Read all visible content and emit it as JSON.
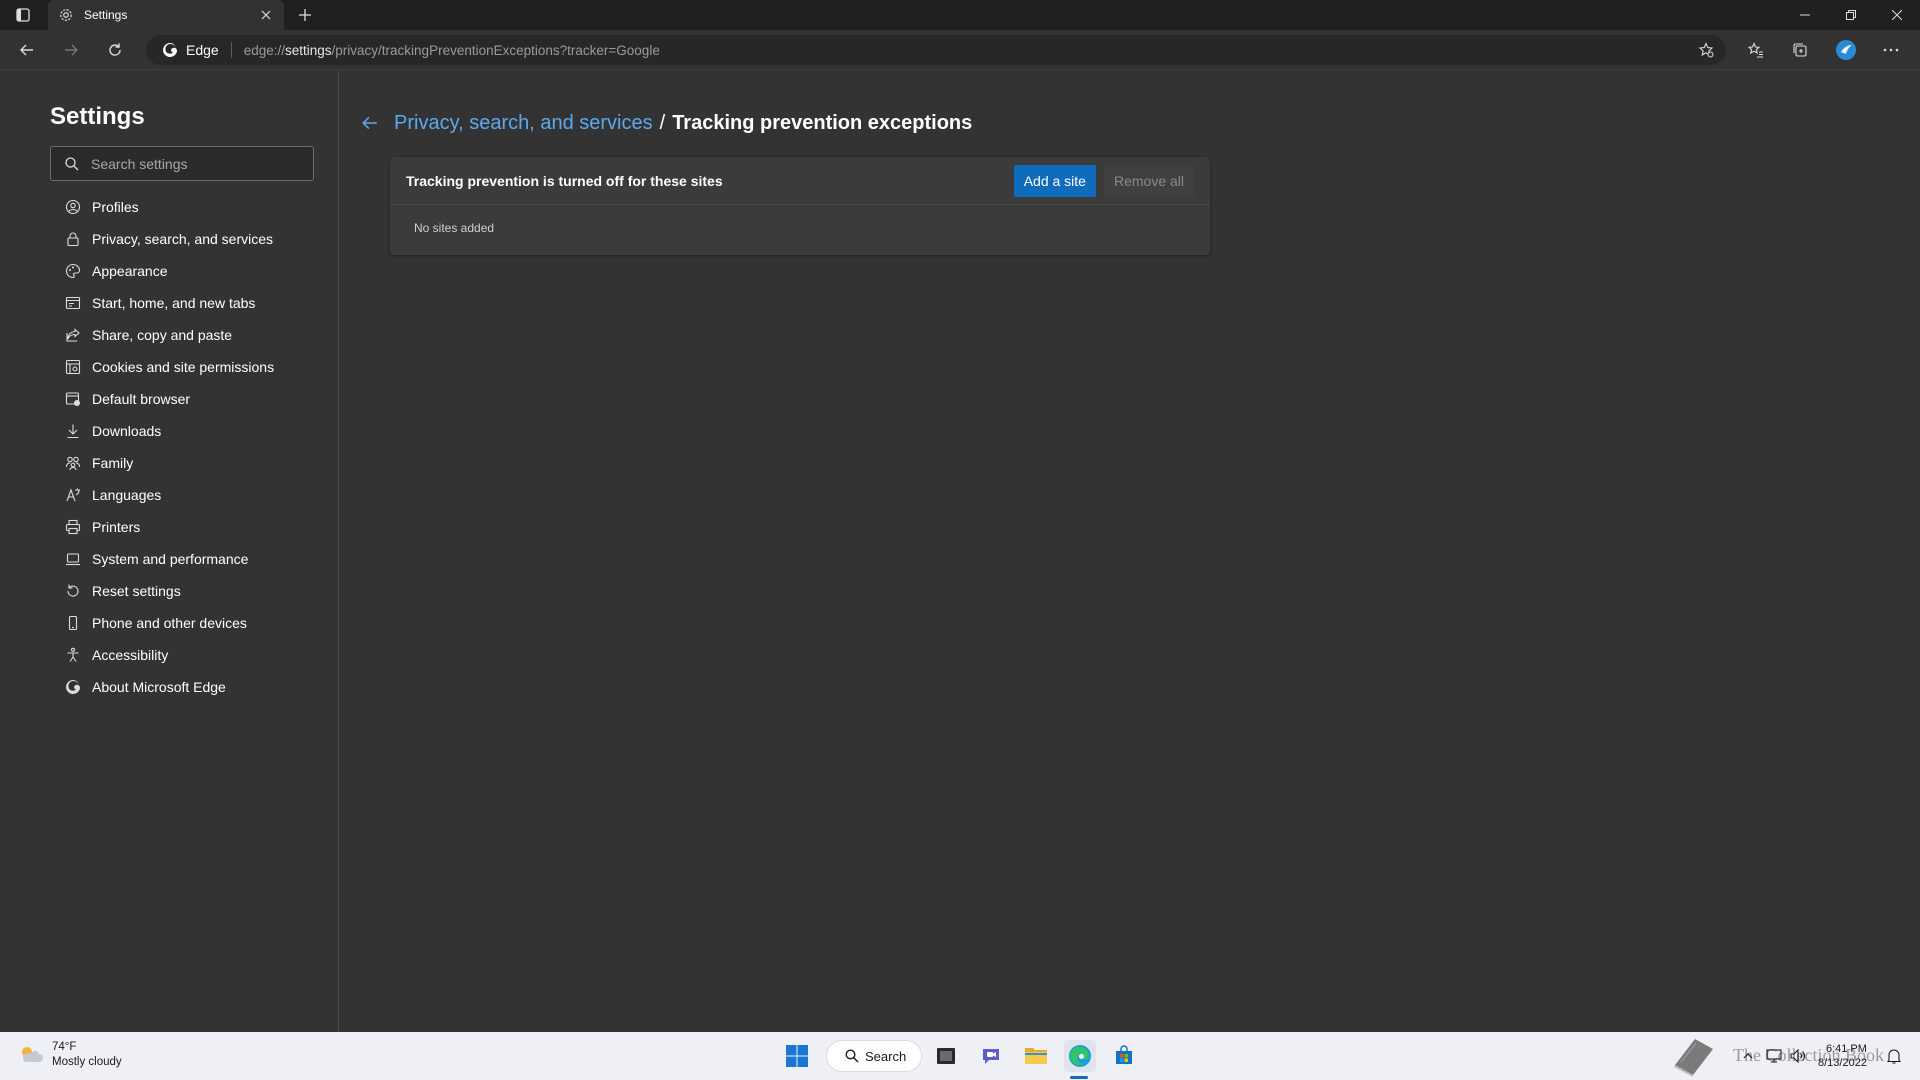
{
  "browser": {
    "tab_title": "Settings",
    "omnibox_brand": "Edge",
    "url_prefix": "edge://",
    "url_host": "settings",
    "url_path": "/privacy/trackingPreventionExceptions?tracker=Google"
  },
  "sidebar": {
    "title": "Settings",
    "search_placeholder": "Search settings",
    "items": [
      {
        "label": "Profiles",
        "icon": "profile-icon"
      },
      {
        "label": "Privacy, search, and services",
        "icon": "lock-icon"
      },
      {
        "label": "Appearance",
        "icon": "palette-icon"
      },
      {
        "label": "Start, home, and new tabs",
        "icon": "home-tabs-icon"
      },
      {
        "label": "Share, copy and paste",
        "icon": "share-icon"
      },
      {
        "label": "Cookies and site permissions",
        "icon": "cookies-icon"
      },
      {
        "label": "Default browser",
        "icon": "default-browser-icon"
      },
      {
        "label": "Downloads",
        "icon": "download-icon"
      },
      {
        "label": "Family",
        "icon": "family-icon"
      },
      {
        "label": "Languages",
        "icon": "languages-icon"
      },
      {
        "label": "Printers",
        "icon": "printer-icon"
      },
      {
        "label": "System and performance",
        "icon": "laptop-icon"
      },
      {
        "label": "Reset settings",
        "icon": "reset-icon"
      },
      {
        "label": "Phone and other devices",
        "icon": "phone-icon"
      },
      {
        "label": "Accessibility",
        "icon": "accessibility-icon"
      },
      {
        "label": "About Microsoft Edge",
        "icon": "edge-logo-icon"
      }
    ]
  },
  "main": {
    "breadcrumb_parent": "Privacy, search, and services",
    "breadcrumb_separator": "/",
    "breadcrumb_current": "Tracking prevention exceptions",
    "card_title": "Tracking prevention is turned off for these sites",
    "add_button": "Add a site",
    "remove_button": "Remove all",
    "empty_text": "No sites added"
  },
  "taskbar": {
    "temperature": "74°F",
    "weather": "Mostly cloudy",
    "search_label": "Search",
    "time": "6:41 PM",
    "date": "8/13/2022",
    "watermark": "The Collection Book"
  },
  "colors": {
    "accent": "#0f6cbd",
    "link": "#5ca9f0",
    "background": "#333333"
  }
}
